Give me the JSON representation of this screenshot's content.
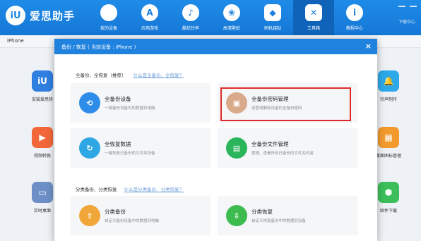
{
  "app": {
    "logo_mark": "iU",
    "title": "爱思助手"
  },
  "nav": [
    {
      "label": "我的设备",
      "icon": "apple-icon",
      "glyph": ""
    },
    {
      "label": "应用游戏",
      "icon": "appstore-icon",
      "glyph": "A"
    },
    {
      "label": "酷炫铃声",
      "icon": "bell-icon",
      "glyph": "♪"
    },
    {
      "label": "高清壁纸",
      "icon": "wallpaper-icon",
      "glyph": "❀"
    },
    {
      "label": "刷机越狱",
      "icon": "dropbox-icon",
      "glyph": "◆"
    },
    {
      "label": "工具箱",
      "icon": "toolbox-icon",
      "glyph": "✕"
    },
    {
      "label": "教程中心",
      "icon": "info-icon",
      "glyph": "i"
    }
  ],
  "download_center": "下载中心",
  "device_tab": "iPhone",
  "background_apps": [
    {
      "label": "安装爱思移",
      "icon": "aisi-app-icon",
      "glyph": "iU",
      "color": "#2f7fe0"
    },
    {
      "label": "视频转换",
      "icon": "video-convert-icon",
      "glyph": "▶",
      "color": "#f2683a"
    },
    {
      "label": "实时桌面",
      "icon": "desktop-icon",
      "glyph": "▭",
      "color": "#6d8fc7"
    },
    {
      "label": "铃声制作",
      "icon": "bell-make-icon",
      "glyph": "🔔",
      "color": "#2da8e8"
    },
    {
      "label": "桌面图标管理",
      "icon": "icon-manage-icon",
      "glyph": "▦",
      "color": "#f29a2e"
    },
    {
      "label": "固件下载",
      "icon": "firmware-icon",
      "glyph": "⬢",
      "color": "#3cbf5a"
    }
  ],
  "dialog": {
    "title": "备份 / 恢复   ( 当前设备 : iPhone )",
    "close": "×",
    "section1": {
      "label": "全备份、全恢复（推荐）",
      "link": "什么是全备份、全恢复？"
    },
    "section2": {
      "label": "分类备份、分类恢复",
      "link": "什么是分类备份、分类恢复？"
    },
    "cards": [
      {
        "title": "全备份设备",
        "desc": "一键备份设备内的数据到电脑",
        "icon": "backup-clock-icon",
        "color": "#2d8de8"
      },
      {
        "title": "全备份密码管理",
        "desc": "设置或删除设备的全备份密码",
        "icon": "lock-icon",
        "color": "#d9a98c"
      },
      {
        "title": "全恢复数据",
        "desc": "一键恢复已备份的文件到设备",
        "icon": "restore-icon",
        "color": "#2fa7e5"
      },
      {
        "title": "全备份文件管理",
        "desc": "管理、查看所有已备份的文件及内容",
        "icon": "folder-icon",
        "color": "#2bb55a"
      },
      {
        "title": "分类备份",
        "desc": "自定义备份设备中的数据到电脑",
        "icon": "category-backup-icon",
        "color": "#f1a63a"
      },
      {
        "title": "分类恢复",
        "desc": "自定义恢复备份中的数据到设备",
        "icon": "category-restore-icon",
        "color": "#3dbb4f"
      }
    ]
  }
}
